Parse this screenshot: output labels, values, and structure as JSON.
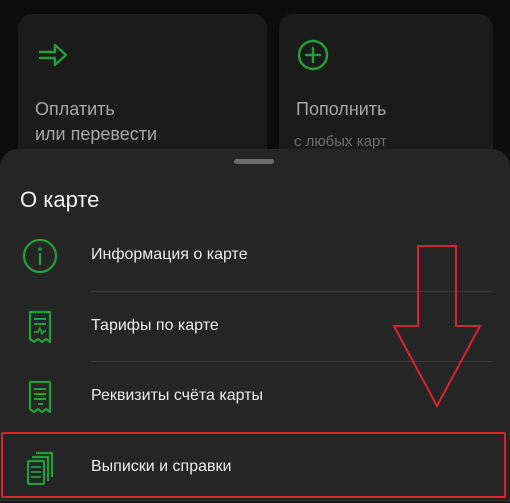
{
  "tiles": [
    {
      "title": "Оплатить\nили перевести",
      "subtitle": "",
      "icon": "transfer-arrow-icon"
    },
    {
      "title": "Пополнить",
      "subtitle": "с любых карт",
      "icon": "plus-circle-icon"
    }
  ],
  "sheet": {
    "title": "О карте",
    "items": [
      {
        "label": "Информация о карте",
        "icon": "info-icon"
      },
      {
        "label": "Тарифы по карте",
        "icon": "tariff-document-icon"
      },
      {
        "label": "Реквизиты счёта карты",
        "icon": "requisites-document-icon"
      },
      {
        "label": "Выписки и справки",
        "icon": "statements-documents-icon"
      }
    ]
  },
  "colors": {
    "accent": "#21a038",
    "annotation": "#d9232d",
    "sheet_background": "#252525",
    "tile_background": "#1b1b1b"
  }
}
